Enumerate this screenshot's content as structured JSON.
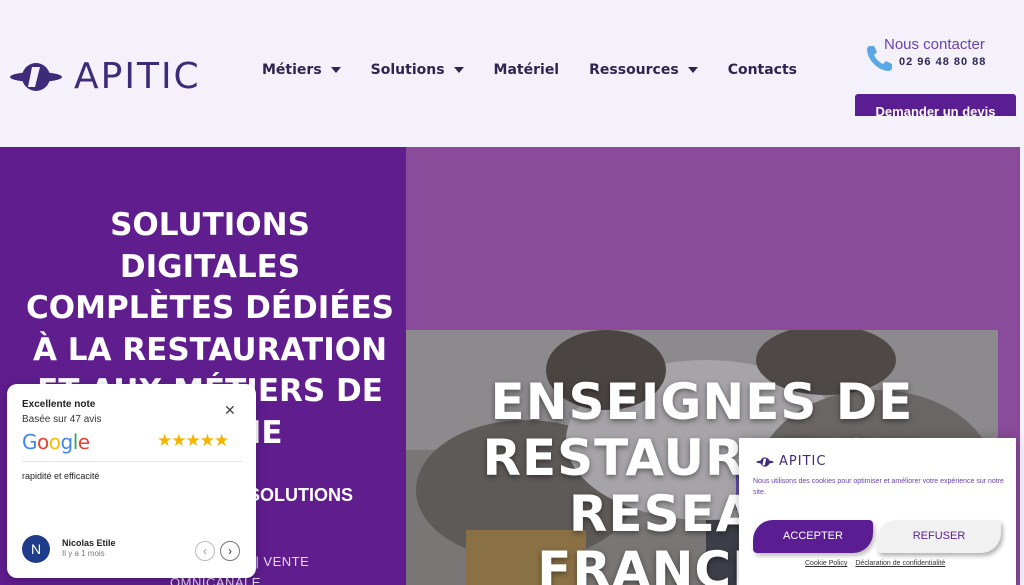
{
  "header": {
    "brand": "APITIC",
    "nav": [
      {
        "label": "Métiers",
        "has_caret": true
      },
      {
        "label": "Solutions",
        "has_caret": true
      },
      {
        "label": "Matériel",
        "has_caret": false
      },
      {
        "label": "Ressources",
        "has_caret": true
      },
      {
        "label": "Contacts",
        "has_caret": false
      }
    ],
    "contact_title": "Nous contacter",
    "contact_phone": "02 96 48 80 88",
    "devis_label": "Demander un devis"
  },
  "hero": {
    "title": "SOLUTIONS DIGITALES COMPLÈTES DÉDIÉES À LA RESTAURATION ET AUX MÉTIERS DE BOUCHE",
    "subtitle": "SOLUTIONS",
    "features": "DÉLISATION | VENTE OMNICANALE",
    "photo_title": "ENSEIGNES DE RESTAURATION RESEAUX FRANCHISE"
  },
  "review": {
    "title": "Excellente note",
    "subtitle": "Basée sur 47 avis",
    "rating_stars": "★★★★★",
    "text": "rapidité et efficacité",
    "avatar_letter": "N",
    "reviewer": "Nicolas Etile",
    "time": "Il y a 1 mois"
  },
  "cookie": {
    "brand": "APITIC",
    "text": "Nous utilisons des cookies pour optimiser et améliorer votre expérience sur notre site.",
    "accept_label": "ACCEPTER",
    "refuse_label": "REFUSER",
    "link_policy": "Cookie Policy",
    "link_privacy": "Déclaration de confidentialité"
  },
  "colors": {
    "brand_purple": "#5f1d8e",
    "hero_right": "#8a4b9a",
    "header_bg": "#f4f1fa"
  }
}
